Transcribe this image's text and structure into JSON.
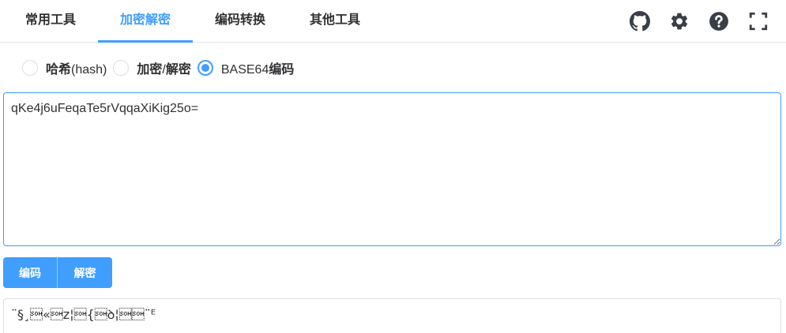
{
  "tabs": [
    {
      "label": "常用工具",
      "active": false
    },
    {
      "label": "加密解密",
      "active": true
    },
    {
      "label": "编码转换",
      "active": false
    },
    {
      "label": "其他工具",
      "active": false
    }
  ],
  "toolbar_icons": [
    "github-icon",
    "gear-icon",
    "help-icon",
    "fullscreen-icon"
  ],
  "radio_options": [
    {
      "label": "哈希",
      "suffix": "(hash)",
      "checked": false
    },
    {
      "label": "加密",
      "suffix": "/",
      "label2": "解密",
      "checked": false
    },
    {
      "label": "BASE64",
      "label2": "编码",
      "checked": true
    }
  ],
  "input": {
    "value": "qKe4j6uFeqaTe5rVqqaXiKig25o="
  },
  "buttons": {
    "encode_label": "编码",
    "decode_label": "解密"
  },
  "output": {
    "value": "¨§¸\u0001«\u0001z¦\u0001{\u0001ꝺ¦\u0001\u0001¨ᴱ"
  },
  "colors": {
    "accent": "#409eff",
    "text": "#303133",
    "border": "#dcdfe6"
  }
}
